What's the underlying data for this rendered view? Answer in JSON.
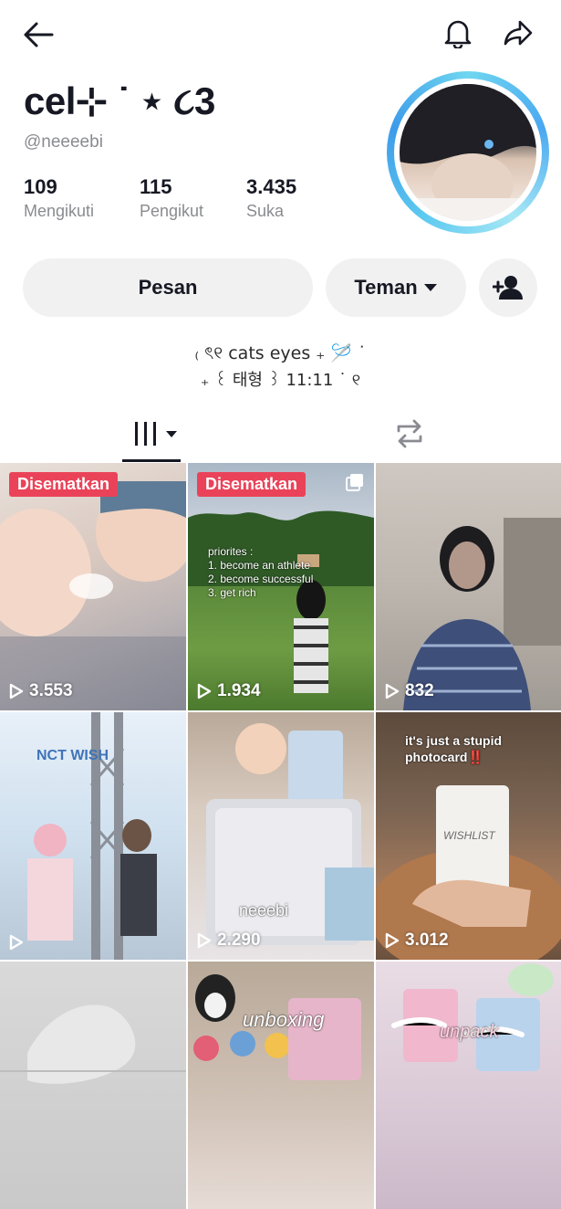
{
  "header": {
    "back_icon": "arrow-left-icon",
    "bell_icon": "bell-icon",
    "share_icon": "share-arrow-icon"
  },
  "profile": {
    "display_name": "cel⊹ ˙ ⋆ ૮3",
    "username": "@neeeebi",
    "stats": [
      {
        "value": "109",
        "label": "Mengikuti"
      },
      {
        "value": "115",
        "label": "Pengikut"
      },
      {
        "value": "3.435",
        "label": "Suka"
      }
    ],
    "avatar_ring_color": "#4aa8f0"
  },
  "actions": {
    "message_label": "Pesan",
    "friends_label": "Teman",
    "add_friend_icon": "person-add-icon"
  },
  "bio": {
    "line1": "₍ ৎ୧ cats eyes ₊ 🪡 ˙",
    "line2": "₊ ꒰ 태형 ꒱ 11:11 ˙ ୧"
  },
  "tabs": {
    "videos_icon": "grid-icon",
    "reposts_icon": "repost-icon"
  },
  "videos": [
    {
      "pinned": true,
      "pinned_label": "Disematkan",
      "views": "3.553"
    },
    {
      "pinned": true,
      "pinned_label": "Disematkan",
      "views": "1.934",
      "caption": [
        "priorites :",
        "1. become an athlete",
        "2. become successful",
        "3. get rich"
      ]
    },
    {
      "pinned": false,
      "views": "832"
    },
    {
      "pinned": false,
      "views": "",
      "overlay_text": "NCT WISH"
    },
    {
      "pinned": false,
      "views": "2.290",
      "overlay_text": "neeebi"
    },
    {
      "pinned": false,
      "views": "3.012",
      "caption": [
        "it's just a stupid",
        "photocard‼️"
      ],
      "card_text": "WISHLIST"
    },
    {
      "pinned": false,
      "views": ""
    },
    {
      "pinned": false,
      "views": "",
      "overlay_text": "unboxing"
    },
    {
      "pinned": false,
      "views": "",
      "overlay_text": "unpack"
    }
  ],
  "colors": {
    "accent_red": "#ea4359",
    "pill_bg": "#f1f1f2",
    "muted_text": "#8a8b91"
  }
}
